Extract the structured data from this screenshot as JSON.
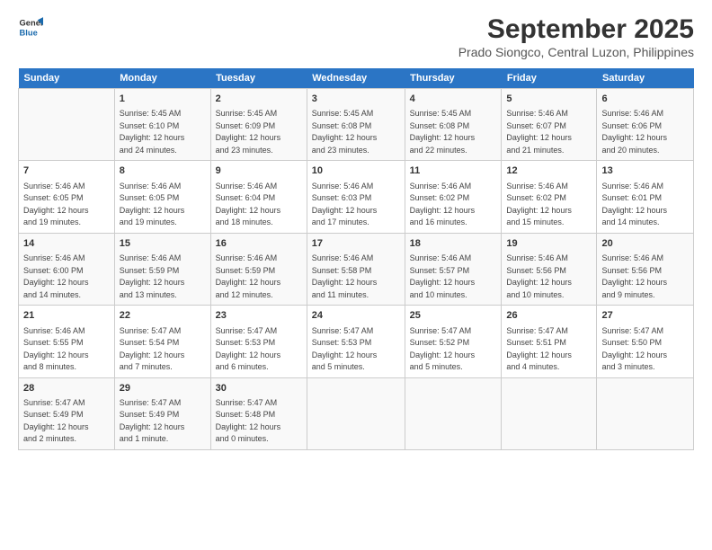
{
  "header": {
    "logo_line1": "General",
    "logo_line2": "Blue",
    "month_title": "September 2025",
    "subtitle": "Prado Siongco, Central Luzon, Philippines"
  },
  "days_of_week": [
    "Sunday",
    "Monday",
    "Tuesday",
    "Wednesday",
    "Thursday",
    "Friday",
    "Saturday"
  ],
  "weeks": [
    [
      {
        "day": "",
        "content": ""
      },
      {
        "day": "1",
        "content": "Sunrise: 5:45 AM\nSunset: 6:10 PM\nDaylight: 12 hours\nand 24 minutes."
      },
      {
        "day": "2",
        "content": "Sunrise: 5:45 AM\nSunset: 6:09 PM\nDaylight: 12 hours\nand 23 minutes."
      },
      {
        "day": "3",
        "content": "Sunrise: 5:45 AM\nSunset: 6:08 PM\nDaylight: 12 hours\nand 23 minutes."
      },
      {
        "day": "4",
        "content": "Sunrise: 5:45 AM\nSunset: 6:08 PM\nDaylight: 12 hours\nand 22 minutes."
      },
      {
        "day": "5",
        "content": "Sunrise: 5:46 AM\nSunset: 6:07 PM\nDaylight: 12 hours\nand 21 minutes."
      },
      {
        "day": "6",
        "content": "Sunrise: 5:46 AM\nSunset: 6:06 PM\nDaylight: 12 hours\nand 20 minutes."
      }
    ],
    [
      {
        "day": "7",
        "content": "Sunrise: 5:46 AM\nSunset: 6:05 PM\nDaylight: 12 hours\nand 19 minutes."
      },
      {
        "day": "8",
        "content": "Sunrise: 5:46 AM\nSunset: 6:05 PM\nDaylight: 12 hours\nand 19 minutes."
      },
      {
        "day": "9",
        "content": "Sunrise: 5:46 AM\nSunset: 6:04 PM\nDaylight: 12 hours\nand 18 minutes."
      },
      {
        "day": "10",
        "content": "Sunrise: 5:46 AM\nSunset: 6:03 PM\nDaylight: 12 hours\nand 17 minutes."
      },
      {
        "day": "11",
        "content": "Sunrise: 5:46 AM\nSunset: 6:02 PM\nDaylight: 12 hours\nand 16 minutes."
      },
      {
        "day": "12",
        "content": "Sunrise: 5:46 AM\nSunset: 6:02 PM\nDaylight: 12 hours\nand 15 minutes."
      },
      {
        "day": "13",
        "content": "Sunrise: 5:46 AM\nSunset: 6:01 PM\nDaylight: 12 hours\nand 14 minutes."
      }
    ],
    [
      {
        "day": "14",
        "content": "Sunrise: 5:46 AM\nSunset: 6:00 PM\nDaylight: 12 hours\nand 14 minutes."
      },
      {
        "day": "15",
        "content": "Sunrise: 5:46 AM\nSunset: 5:59 PM\nDaylight: 12 hours\nand 13 minutes."
      },
      {
        "day": "16",
        "content": "Sunrise: 5:46 AM\nSunset: 5:59 PM\nDaylight: 12 hours\nand 12 minutes."
      },
      {
        "day": "17",
        "content": "Sunrise: 5:46 AM\nSunset: 5:58 PM\nDaylight: 12 hours\nand 11 minutes."
      },
      {
        "day": "18",
        "content": "Sunrise: 5:46 AM\nSunset: 5:57 PM\nDaylight: 12 hours\nand 10 minutes."
      },
      {
        "day": "19",
        "content": "Sunrise: 5:46 AM\nSunset: 5:56 PM\nDaylight: 12 hours\nand 10 minutes."
      },
      {
        "day": "20",
        "content": "Sunrise: 5:46 AM\nSunset: 5:56 PM\nDaylight: 12 hours\nand 9 minutes."
      }
    ],
    [
      {
        "day": "21",
        "content": "Sunrise: 5:46 AM\nSunset: 5:55 PM\nDaylight: 12 hours\nand 8 minutes."
      },
      {
        "day": "22",
        "content": "Sunrise: 5:47 AM\nSunset: 5:54 PM\nDaylight: 12 hours\nand 7 minutes."
      },
      {
        "day": "23",
        "content": "Sunrise: 5:47 AM\nSunset: 5:53 PM\nDaylight: 12 hours\nand 6 minutes."
      },
      {
        "day": "24",
        "content": "Sunrise: 5:47 AM\nSunset: 5:53 PM\nDaylight: 12 hours\nand 5 minutes."
      },
      {
        "day": "25",
        "content": "Sunrise: 5:47 AM\nSunset: 5:52 PM\nDaylight: 12 hours\nand 5 minutes."
      },
      {
        "day": "26",
        "content": "Sunrise: 5:47 AM\nSunset: 5:51 PM\nDaylight: 12 hours\nand 4 minutes."
      },
      {
        "day": "27",
        "content": "Sunrise: 5:47 AM\nSunset: 5:50 PM\nDaylight: 12 hours\nand 3 minutes."
      }
    ],
    [
      {
        "day": "28",
        "content": "Sunrise: 5:47 AM\nSunset: 5:49 PM\nDaylight: 12 hours\nand 2 minutes."
      },
      {
        "day": "29",
        "content": "Sunrise: 5:47 AM\nSunset: 5:49 PM\nDaylight: 12 hours\nand 1 minute."
      },
      {
        "day": "30",
        "content": "Sunrise: 5:47 AM\nSunset: 5:48 PM\nDaylight: 12 hours\nand 0 minutes."
      },
      {
        "day": "",
        "content": ""
      },
      {
        "day": "",
        "content": ""
      },
      {
        "day": "",
        "content": ""
      },
      {
        "day": "",
        "content": ""
      }
    ]
  ]
}
